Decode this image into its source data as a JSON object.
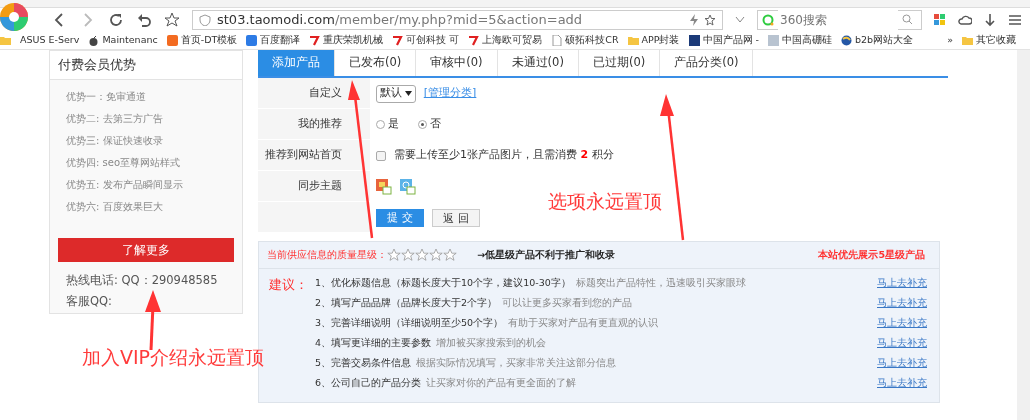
{
  "browser": {
    "address_host": "st03.taomodi.com",
    "address_path": "/member/my.php?mid=5&action=add",
    "search_placeholder": "360搜索",
    "bookmarks": [
      {
        "label": "ASUS E-Serv"
      },
      {
        "label": "Maintenanc"
      },
      {
        "label": "首页-DT模板"
      },
      {
        "label": "百度翻译"
      },
      {
        "label": "重庆荣凯机械"
      },
      {
        "label": "可创科技 可"
      },
      {
        "label": "上海欧可贸易"
      },
      {
        "label": "硕拓科技CR"
      },
      {
        "label": "APP封装"
      },
      {
        "label": "中国产品网 -"
      },
      {
        "label": "中国高硼硅"
      },
      {
        "label": "b2b网站大全"
      }
    ],
    "more": "»",
    "other": "其它收藏"
  },
  "sidebar": {
    "title": "付费会员优势",
    "benefits": [
      "优势一：免审通道",
      "优势二: 去第三方广告",
      "优势三: 保证快速收录",
      "优势四: seo至尊网站样式",
      "优势五: 发布产品瞬间显示",
      "优势六: 百度效果巨大"
    ],
    "button": "了解更多",
    "hotline": "热线电话: QQ：290948585",
    "service_qq": "客服QQ:"
  },
  "tabs": [
    {
      "label": "添加产品",
      "selected": true
    },
    {
      "label": "已发布(0)",
      "selected": false
    },
    {
      "label": "审核中(0)",
      "selected": false
    },
    {
      "label": "未通过(0)",
      "selected": false
    },
    {
      "label": "已过期(0)",
      "selected": false
    },
    {
      "label": "产品分类(0)",
      "selected": false
    }
  ],
  "form": [
    {
      "kind": "select",
      "label": "自定义",
      "value": "默认",
      "link": "[管理分类]"
    },
    {
      "kind": "radio",
      "label": "我的推荐",
      "options": [
        {
          "label": "是",
          "selected": false
        },
        {
          "label": "否",
          "selected": true
        }
      ]
    },
    {
      "kind": "checkbox",
      "label": "推荐到网站首页",
      "checked": false,
      "text": "需要上传至少1张产品图片，且需消费 **2** 积分"
    },
    {
      "kind": "icons",
      "label": "同步主题"
    },
    {
      "kind": "buttons",
      "buttons": [
        {
          "label": "提 交",
          "kind": "submit"
        },
        {
          "label": "返 回",
          "kind": "back"
        }
      ]
    }
  ],
  "quality": {
    "label": "当前供应信息的质量星级：",
    "stars": 0,
    "hint": "→低星级产品不利于推广和收录",
    "notice": "本站优先展示5星级产品",
    "suggest_label": "建议：",
    "items": [
      {
        "title": "1、优化标题信息（标题长度大于10个字，建议10-30字）",
        "desc": "标题突出产品特性，迅速吸引买家眼球",
        "link": "马上去补充"
      },
      {
        "title": "2、填写产品品牌（品牌长度大于2个字）",
        "desc": "可以让更多买家看到您的产品",
        "link": "马上去补充"
      },
      {
        "title": "3、完善详细说明（详细说明至少50个字）",
        "desc": "有助于买家对产品有更直观的认识",
        "link": "马上去补充"
      },
      {
        "title": "4、填写更详细的主要参数",
        "desc": "增加被买家搜索到的机会",
        "link": "马上去补充"
      },
      {
        "title": "5、完善交易条件信息",
        "desc": "根据实际情况填写，买家非常关注这部分信息",
        "link": "马上去补充"
      },
      {
        "title": "6、公司自己的产品分类",
        "desc": "让买家对你的产品有更全面的了解",
        "link": "马上去补充"
      }
    ]
  },
  "annotations": [
    {
      "text": "选项永远置顶"
    },
    {
      "text": "加入VIP介绍永远置顶"
    }
  ]
}
